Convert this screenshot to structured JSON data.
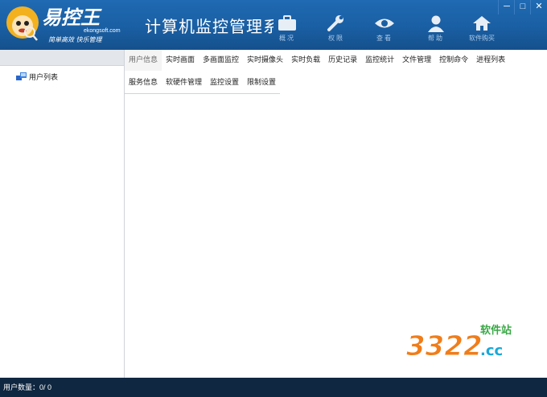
{
  "app": {
    "logo_text": "易控王",
    "logo_site": "ekongsoft.com",
    "logo_slogan": "简单高效 快乐管理",
    "title": "计算机监控管理系统"
  },
  "nav": [
    {
      "label": "概况",
      "icon": "briefcase-icon"
    },
    {
      "label": "权限",
      "icon": "wrench-icon"
    },
    {
      "label": "查看",
      "icon": "eye-icon"
    },
    {
      "label": "帮助",
      "icon": "user-icon"
    },
    {
      "label": "软件购买",
      "icon": "home-icon"
    }
  ],
  "window": {
    "minimize": "─",
    "maximize": "□",
    "close": "✕"
  },
  "sidebar": {
    "tree_item": {
      "label": "用户列表",
      "icon": "network-computers-icon"
    }
  },
  "tabs": {
    "row1": [
      "用户信息",
      "实时画面",
      "多画面监控",
      "实时摄像头",
      "实时负载",
      "历史记录",
      "监控统计",
      "文件管理",
      "控制命令",
      "进程列表"
    ],
    "row2": [
      "服务信息",
      "软硬件管理",
      "监控设置",
      "限制设置"
    ],
    "active": "用户信息"
  },
  "status": {
    "label": "用户数量：",
    "value": "0/ 0"
  },
  "watermark": {
    "digits": "3322",
    "suffix": ".cc",
    "tagline": "软件站"
  },
  "colors": {
    "header_blue": "#1a5fa3",
    "status_bg": "#0f2740",
    "watermark_orange": "#f07d1a",
    "watermark_green": "#38a845",
    "watermark_cyan": "#1ca8d8"
  }
}
